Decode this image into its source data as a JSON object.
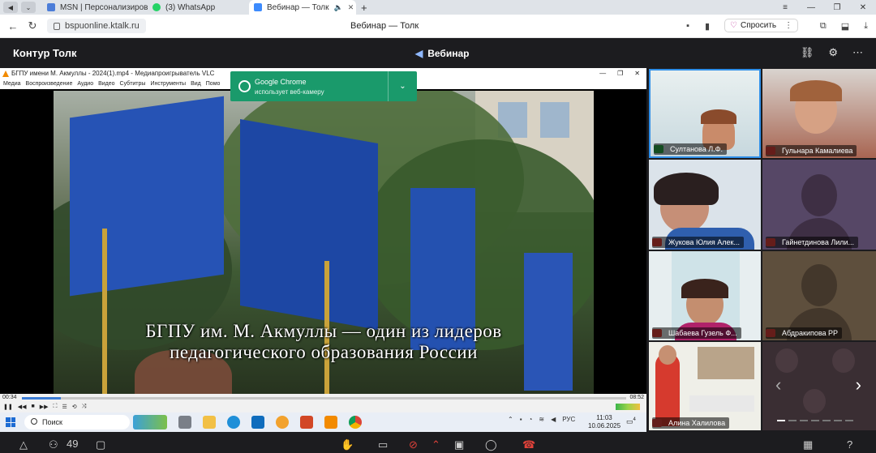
{
  "browser": {
    "tabs": [
      {
        "label": "MSN | Персонализирова",
        "color": "#4c7dd8"
      },
      {
        "label": "(3) WhatsApp",
        "color": "#25d366"
      },
      {
        "label": "Вебинар — Толк",
        "color": "#3d8bfd"
      }
    ],
    "url": "bspuonline.ktalk.ru",
    "page_title": "Вебинар — Толк",
    "ask_label": "Спросить"
  },
  "talk": {
    "brand": "Контур Толк",
    "webinar_label": "Вебинар",
    "participants_count": "49"
  },
  "vlc": {
    "title": "БГПУ имени М. Акмуллы - 2024(1).mp4 - Медиапроигрыватель VLC",
    "menu": [
      "Медиа",
      "Воспроизведение",
      "Аудио",
      "Видео",
      "Субтитры",
      "Инструменты",
      "Вид",
      "Помо"
    ],
    "caption_line1": "БГПУ им. М. Акмуллы — один из лидеров",
    "caption_line2": "педагогического образования России",
    "time_elapsed": "00:34",
    "time_total": "08:52",
    "progress": 0.064
  },
  "notification": {
    "title": "Google Chrome",
    "text": "использует веб-камеру"
  },
  "taskbar": {
    "search_placeholder": "Поиск",
    "language": "РУС",
    "time": "11:03",
    "date": "10.06.2025",
    "notif_count": "4"
  },
  "participants": [
    {
      "name": "Султанова Л.Ф.",
      "mic": "on"
    },
    {
      "name": "Гульнара Камалиева",
      "mic": "muted"
    },
    {
      "name": "Жукова Юлия Алек...",
      "mic": "muted"
    },
    {
      "name": "Гайнетдинова Лили...",
      "mic": "muted"
    },
    {
      "name": "Шабаева Гузель Ф...",
      "mic": "muted"
    },
    {
      "name": "Абдракипова РР",
      "mic": "muted"
    },
    {
      "name": "Алина Халилова",
      "mic": "muted"
    }
  ],
  "colors": {
    "dark_bg": "#1c1c1f",
    "active_speaker_border": "#2f8fe8",
    "mic_on": "#2eaa4a",
    "mic_muted": "#e0423a",
    "notification_bg": "#1a9a6b"
  }
}
